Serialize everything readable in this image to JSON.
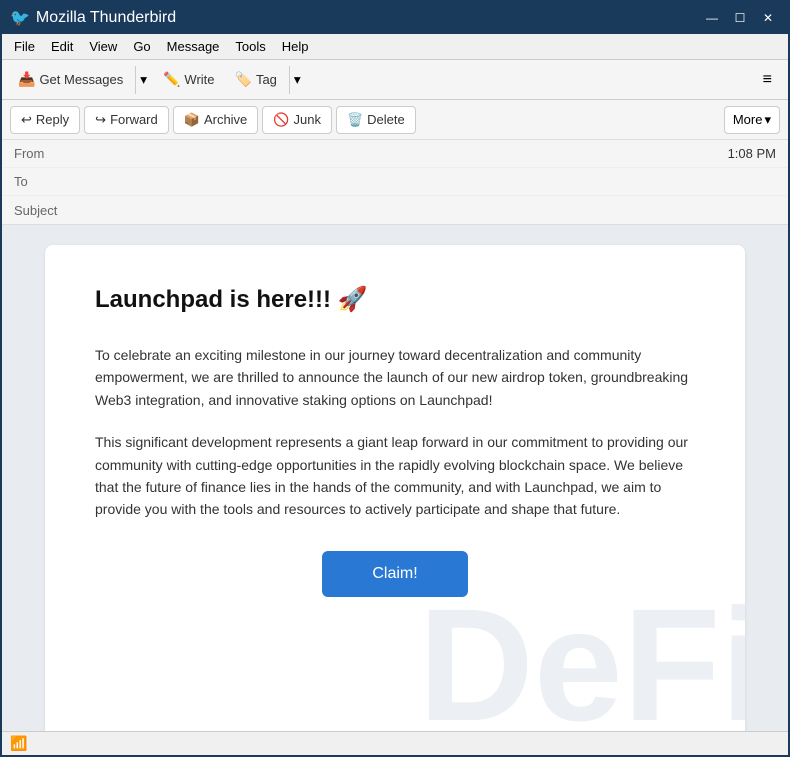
{
  "window": {
    "title": "Mozilla Thunderbird",
    "icon": "🐦"
  },
  "titlebar": {
    "controls": {
      "minimize": "—",
      "maximize": "☐",
      "close": "✕"
    }
  },
  "menubar": {
    "items": [
      {
        "id": "file",
        "label": "File"
      },
      {
        "id": "edit",
        "label": "Edit"
      },
      {
        "id": "view",
        "label": "View"
      },
      {
        "id": "go",
        "label": "Go"
      },
      {
        "id": "message",
        "label": "Message"
      },
      {
        "id": "tools",
        "label": "Tools"
      },
      {
        "id": "help",
        "label": "Help"
      }
    ]
  },
  "toolbar": {
    "get_messages": "Get Messages",
    "get_messages_icon": "📥",
    "write": "Write",
    "write_icon": "✏️",
    "tag": "Tag",
    "tag_icon": "🏷️",
    "hamburger": "≡"
  },
  "actions": {
    "reply_icon": "↩",
    "reply_label": "Reply",
    "forward_icon": "↪",
    "forward_label": "Forward",
    "archive_icon": "📦",
    "archive_label": "Archive",
    "junk_icon": "🚫",
    "junk_label": "Junk",
    "delete_icon": "🗑️",
    "delete_label": "Delete",
    "more_label": "More",
    "more_chevron": "▾"
  },
  "email_header": {
    "from_label": "From",
    "from_value": "",
    "to_label": "To",
    "to_value": "",
    "subject_label": "Subject",
    "subject_value": "",
    "time": "1:08 PM"
  },
  "email_body": {
    "heading": "Launchpad is here!!! 🚀",
    "paragraph1": "To celebrate an exciting milestone in our journey toward decentralization and community empowerment, we are thrilled to announce the launch of our new airdrop token, groundbreaking Web3 integration, and innovative staking options on Launchpad!",
    "paragraph2": "This significant development represents a giant leap forward in our commitment to providing our community with cutting-edge opportunities in the rapidly evolving blockchain space. We believe that the future of finance lies in the hands of the community, and with Launchpad, we aim to provide you with the tools and resources to actively participate and shape that future.",
    "claim_button": "Claim!",
    "watermark": "DeFi"
  },
  "statusbar": {
    "icon": "📶",
    "text": ""
  }
}
